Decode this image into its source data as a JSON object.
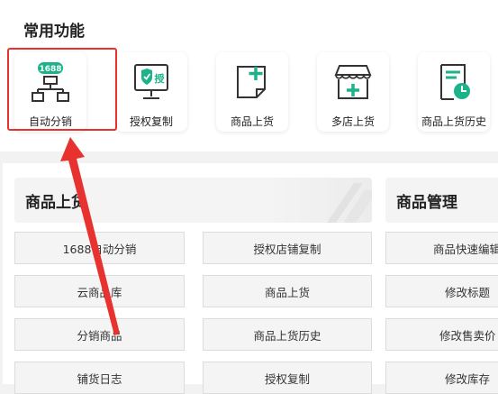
{
  "common": {
    "title": "常用功能",
    "cards": [
      {
        "label": "自动分销",
        "icon": "distribution-1688-icon",
        "badge": "1688"
      },
      {
        "label": "授权复制",
        "icon": "authorize-copy-icon",
        "badge": "授"
      },
      {
        "label": "商品上货",
        "icon": "product-upload-icon"
      },
      {
        "label": "多店上货",
        "icon": "multi-store-icon"
      },
      {
        "label": "商品上货历史",
        "icon": "upload-history-icon"
      }
    ]
  },
  "panels": {
    "upload": {
      "title": "商品上货",
      "buttons": [
        [
          "1688自动分销",
          "授权店铺复制"
        ],
        [
          "云商品库",
          "商品上货"
        ],
        [
          "分销商品",
          "商品上货历史"
        ],
        [
          "铺货日志",
          "授权复制"
        ]
      ]
    },
    "manage": {
      "title": "商品管理",
      "buttons": [
        "商品快速编辑",
        "修改标题",
        "修改售卖价",
        "修改库存"
      ]
    }
  },
  "colors": {
    "accent": "#1db38a",
    "highlight": "#e8322f",
    "icon_dark": "#333333"
  }
}
